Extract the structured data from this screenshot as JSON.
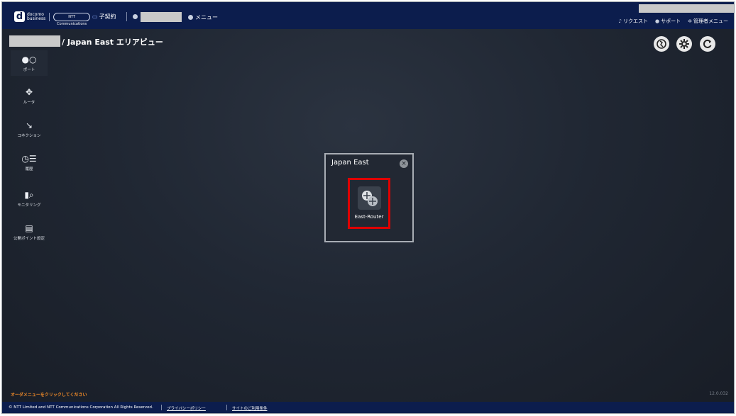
{
  "header": {
    "brand_line1": "docomo",
    "brand_line2": "business",
    "ntt_logo_text": "NTT Communications",
    "sub_contract": "子契約",
    "menu": "メニュー",
    "links": {
      "request": "リクエスト",
      "support": "サポート",
      "admin_menu": "管理者メニュー"
    }
  },
  "page": {
    "title": "/ Japan East エリアビュー"
  },
  "toolbar": {
    "globe": "globe-icon",
    "settings": "gear-icon",
    "refresh": "refresh-icon"
  },
  "sidebar": {
    "items": [
      {
        "label": "ポート",
        "icon": "port-icon"
      },
      {
        "label": "ルータ",
        "icon": "router-icon"
      },
      {
        "label": "コネクション",
        "icon": "connection-icon"
      },
      {
        "label": "履歴",
        "icon": "history-icon"
      },
      {
        "label": "モニタリング",
        "icon": "monitoring-icon"
      },
      {
        "label": "公開ポイント設定",
        "icon": "public-point-icon"
      }
    ]
  },
  "area_panel": {
    "title": "Japan East",
    "router_label": "East-Router"
  },
  "footer": {
    "order_hint": "オーダメニューをクリックしてください",
    "version": "12.0.032",
    "copyright": "© NTT Limited and NTT Communications Corporation All Rights Reserved.",
    "privacy": "プライバシーポリシー",
    "terms": "サイトのご利用条件"
  },
  "colors": {
    "topbar": "#0c1d4d",
    "highlight": "#e00000",
    "hint": "#f08a28"
  }
}
